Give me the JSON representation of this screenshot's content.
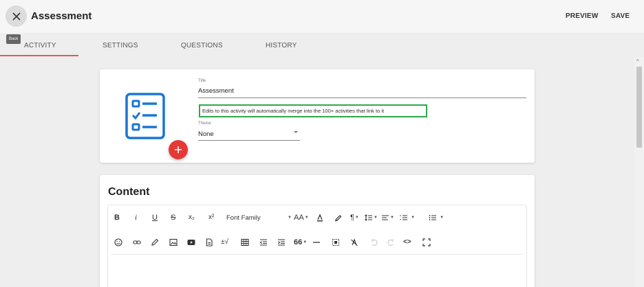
{
  "header": {
    "title": "Assessment",
    "back_tooltip": "Back",
    "preview_label": "PREVIEW",
    "save_label": "SAVE"
  },
  "tabs": [
    {
      "label": "ACTIVITY",
      "active": true
    },
    {
      "label": "SETTINGS",
      "active": false
    },
    {
      "label": "QUESTIONS",
      "active": false
    },
    {
      "label": "HISTORY",
      "active": false
    }
  ],
  "activity_card": {
    "icon": "checklist-icon",
    "add_button_icon": "plus-icon",
    "title_label": "Title",
    "title_value": "Assessment",
    "merge_notice": "Edits to this activity will automatically merge into the 100+ activities that link to it",
    "theme_label": "Theme",
    "theme_value": "None"
  },
  "content_card": {
    "heading": "Content",
    "toolbar": {
      "bold": "B",
      "italic": "i",
      "underline": "U",
      "strikethrough": "S",
      "subscript": "x₂",
      "superscript": "x²",
      "font_family": "Font Family",
      "font_size": "AA",
      "math": "±√",
      "quote": "66",
      "code": "<>"
    }
  },
  "colors": {
    "accent": "#e8584b",
    "fab": "#e53935",
    "notice_border": "#2ea84a",
    "icon_blue": "#1976d2"
  }
}
